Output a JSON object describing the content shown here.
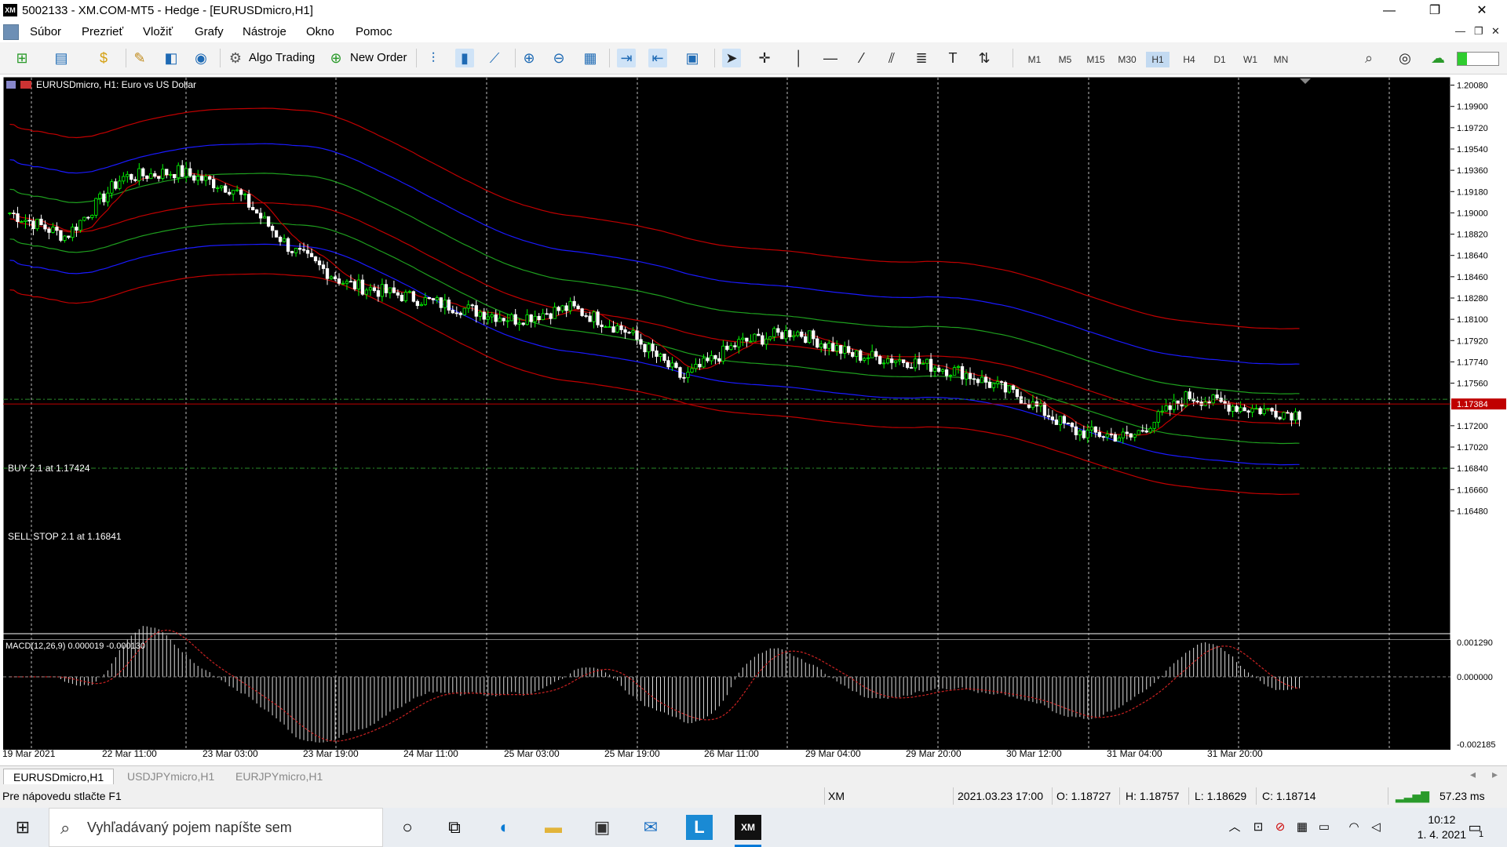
{
  "window": {
    "title": "5002133 - XM.COM-MT5 - Hedge - [EURUSDmicro,H1]",
    "logo_text": "XM",
    "controls": [
      "—",
      "❐",
      "✕"
    ]
  },
  "menu": {
    "items": [
      "Súbor",
      "Prezrieť",
      "Vložiť",
      "Grafy",
      "Nástroje",
      "Okno",
      "Pomoc"
    ],
    "child_controls": [
      "—",
      "❐",
      "✕"
    ]
  },
  "toolbar": {
    "algo_trading_label": "Algo Trading",
    "new_order_label": "New Order",
    "timeframes": [
      "M1",
      "M5",
      "M15",
      "M30",
      "H1",
      "H4",
      "D1",
      "W1",
      "MN"
    ],
    "active_timeframe": "H1"
  },
  "chart": {
    "header": "EURUSDmicro, H1:  Euro vs US Dollar",
    "buy_line_label": "BUY 2.1 at 1.17424",
    "sell_stop_label": "SELL STOP 2.1 at 1.16841",
    "current_price": "1.17384",
    "price_ticks": [
      "1.20080",
      "1.19900",
      "1.19720",
      "1.19540",
      "1.19360",
      "1.19180",
      "1.19000",
      "1.18820",
      "1.18640",
      "1.18460",
      "1.18280",
      "1.18100",
      "1.17920",
      "1.17740",
      "1.17560",
      "1.17200",
      "1.17020",
      "1.16840",
      "1.16660",
      "1.16480"
    ],
    "macd_label": "MACD(12,26,9) 0.000019 -0.000130",
    "macd_ticks": [
      "0.001290",
      "0.000000",
      "-0.002185"
    ],
    "time_labels": [
      "19 Mar 2021",
      "22 Mar 11:00",
      "23 Mar 03:00",
      "23 Mar 19:00",
      "24 Mar 11:00",
      "25 Mar 03:00",
      "25 Mar 19:00",
      "26 Mar 11:00",
      "29 Mar 04:00",
      "29 Mar 20:00",
      "30 Mar 12:00",
      "31 Mar 04:00",
      "31 Mar 20:00"
    ],
    "colors": {
      "background": "#000000",
      "bull": "#00ff00",
      "bear": "#ffffff",
      "red_band": "#c00000",
      "blue_band": "#1a1aff",
      "green_band": "#1e9e1e",
      "macd_signal": "#cc2222"
    }
  },
  "chart_data": {
    "type": "candlestick",
    "symbol": "EURUSDmicro",
    "timeframe": "H1",
    "y_range": [
      1.1639,
      1.2015
    ],
    "close_path_anchors": [
      1.19,
      1.188,
      1.193,
      1.1935,
      1.192,
      1.187,
      1.184,
      1.183,
      1.182,
      1.181,
      1.182,
      1.18,
      1.176,
      1.179,
      1.18,
      1.178,
      1.1775,
      1.1765,
      1.1745,
      1.1715,
      1.171,
      1.1745,
      1.1735,
      1.173
    ],
    "buy_price": 1.17424,
    "sell_stop_price": 1.16841,
    "current_price": 1.17384,
    "macd": {
      "value": 1.9e-05,
      "signal": -0.00013,
      "y_range": [
        -0.002185,
        0.00129
      ]
    }
  },
  "tabs": [
    "EURUSDmicro,H1",
    "USDJPYmicro,H1",
    "EURJPYmicro,H1"
  ],
  "status": {
    "help": "Pre nápovedu stlačte F1",
    "server": "XM",
    "datetime": "2021.03.23 17:00",
    "open": "O: 1.18727",
    "high": "H: 1.18757",
    "low": "L: 1.18629",
    "close": "C: 1.18714",
    "ping": "57.23 ms"
  },
  "taskbar": {
    "search_placeholder": "Vyhľadávaný pojem napíšte sem",
    "time": "10:12",
    "date": "1. 4. 2021",
    "notification_count": "1"
  }
}
